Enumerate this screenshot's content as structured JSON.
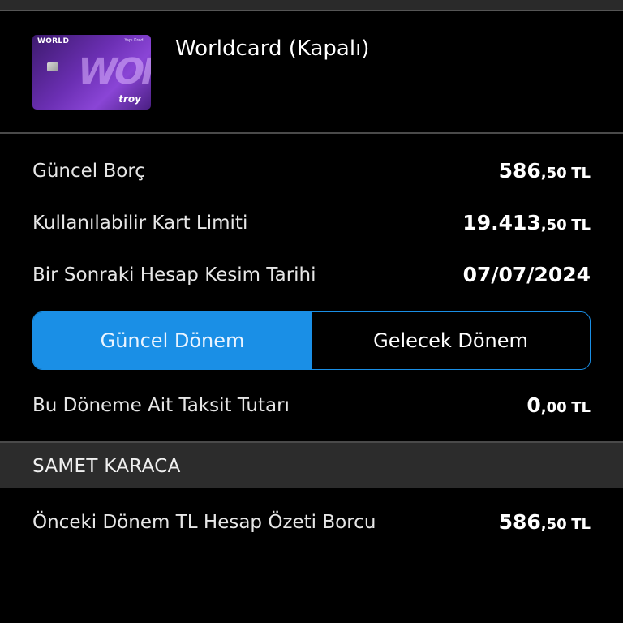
{
  "card": {
    "title": "Worldcard (Kapalı)",
    "thumb_brand": "WORLD",
    "thumb_bank": "Yapı Kredi",
    "thumb_word": "WORLD",
    "thumb_network": "troy"
  },
  "summary": {
    "current_debt": {
      "label": "Güncel Borç",
      "int": "586",
      "dec": ",50",
      "cur": "TL"
    },
    "available_limit": {
      "label": "Kullanılabilir Kart Limiti",
      "int": "19.413",
      "dec": ",50",
      "cur": "TL"
    },
    "next_statement": {
      "label": "Bir Sonraki Hesap Kesim Tarihi",
      "date": "07/07/2024"
    }
  },
  "period_tabs": {
    "current": "Güncel Dönem",
    "future": "Gelecek Dönem",
    "selected": "current"
  },
  "installment": {
    "label": "Bu Döneme Ait Taksit Tutarı",
    "int": "0",
    "dec": ",00",
    "cur": "TL"
  },
  "holder": {
    "name": "SAMET KARACA"
  },
  "previous_statement": {
    "label": "Önceki Dönem TL Hesap Özeti Borcu",
    "int": "586",
    "dec": ",50",
    "cur": "TL"
  },
  "colors": {
    "accent": "#1a8fe6",
    "background": "#000000",
    "section_header": "#2c2c2c",
    "card_purple": "#6b2fb3"
  }
}
